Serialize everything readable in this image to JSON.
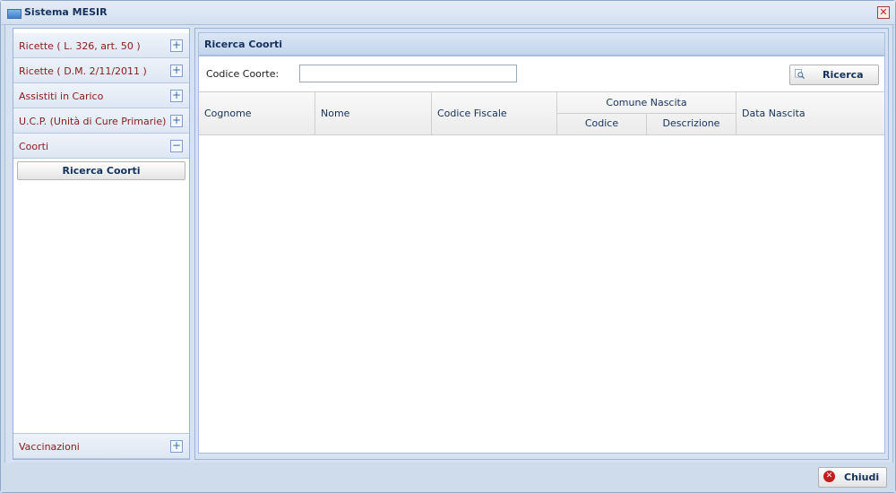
{
  "window": {
    "title": "Sistema MESIR",
    "close_glyph": "✕"
  },
  "sidebar": {
    "items": [
      {
        "label": "Ricette ( L. 326, art. 50 )",
        "toggle": "+"
      },
      {
        "label": "Ricette ( D.M. 2/11/2011 )",
        "toggle": "+"
      },
      {
        "label": "Assistiti in Carico",
        "toggle": "+"
      },
      {
        "label": "U.C.P. (Unità di Cure Primarie)",
        "toggle": "+"
      },
      {
        "label": "Coorti",
        "toggle": "−"
      }
    ],
    "submenu": {
      "button_label": "Ricerca Coorti"
    },
    "bottom_item": {
      "label": "Vaccinazioni",
      "toggle": "+"
    }
  },
  "main": {
    "panel_title": "Ricerca Coorti",
    "search": {
      "field_label": "Codice Coorte:",
      "field_value": "",
      "button_label": "Ricerca"
    },
    "table": {
      "columns": [
        "Cognome",
        "Nome",
        "Codice Fiscale"
      ],
      "group_header": "Comune Nascita",
      "group_columns": [
        "Codice",
        "Descrizione"
      ],
      "last_column": "Data Nascita",
      "rows": []
    }
  },
  "footer": {
    "close_label": "Chiudi"
  }
}
